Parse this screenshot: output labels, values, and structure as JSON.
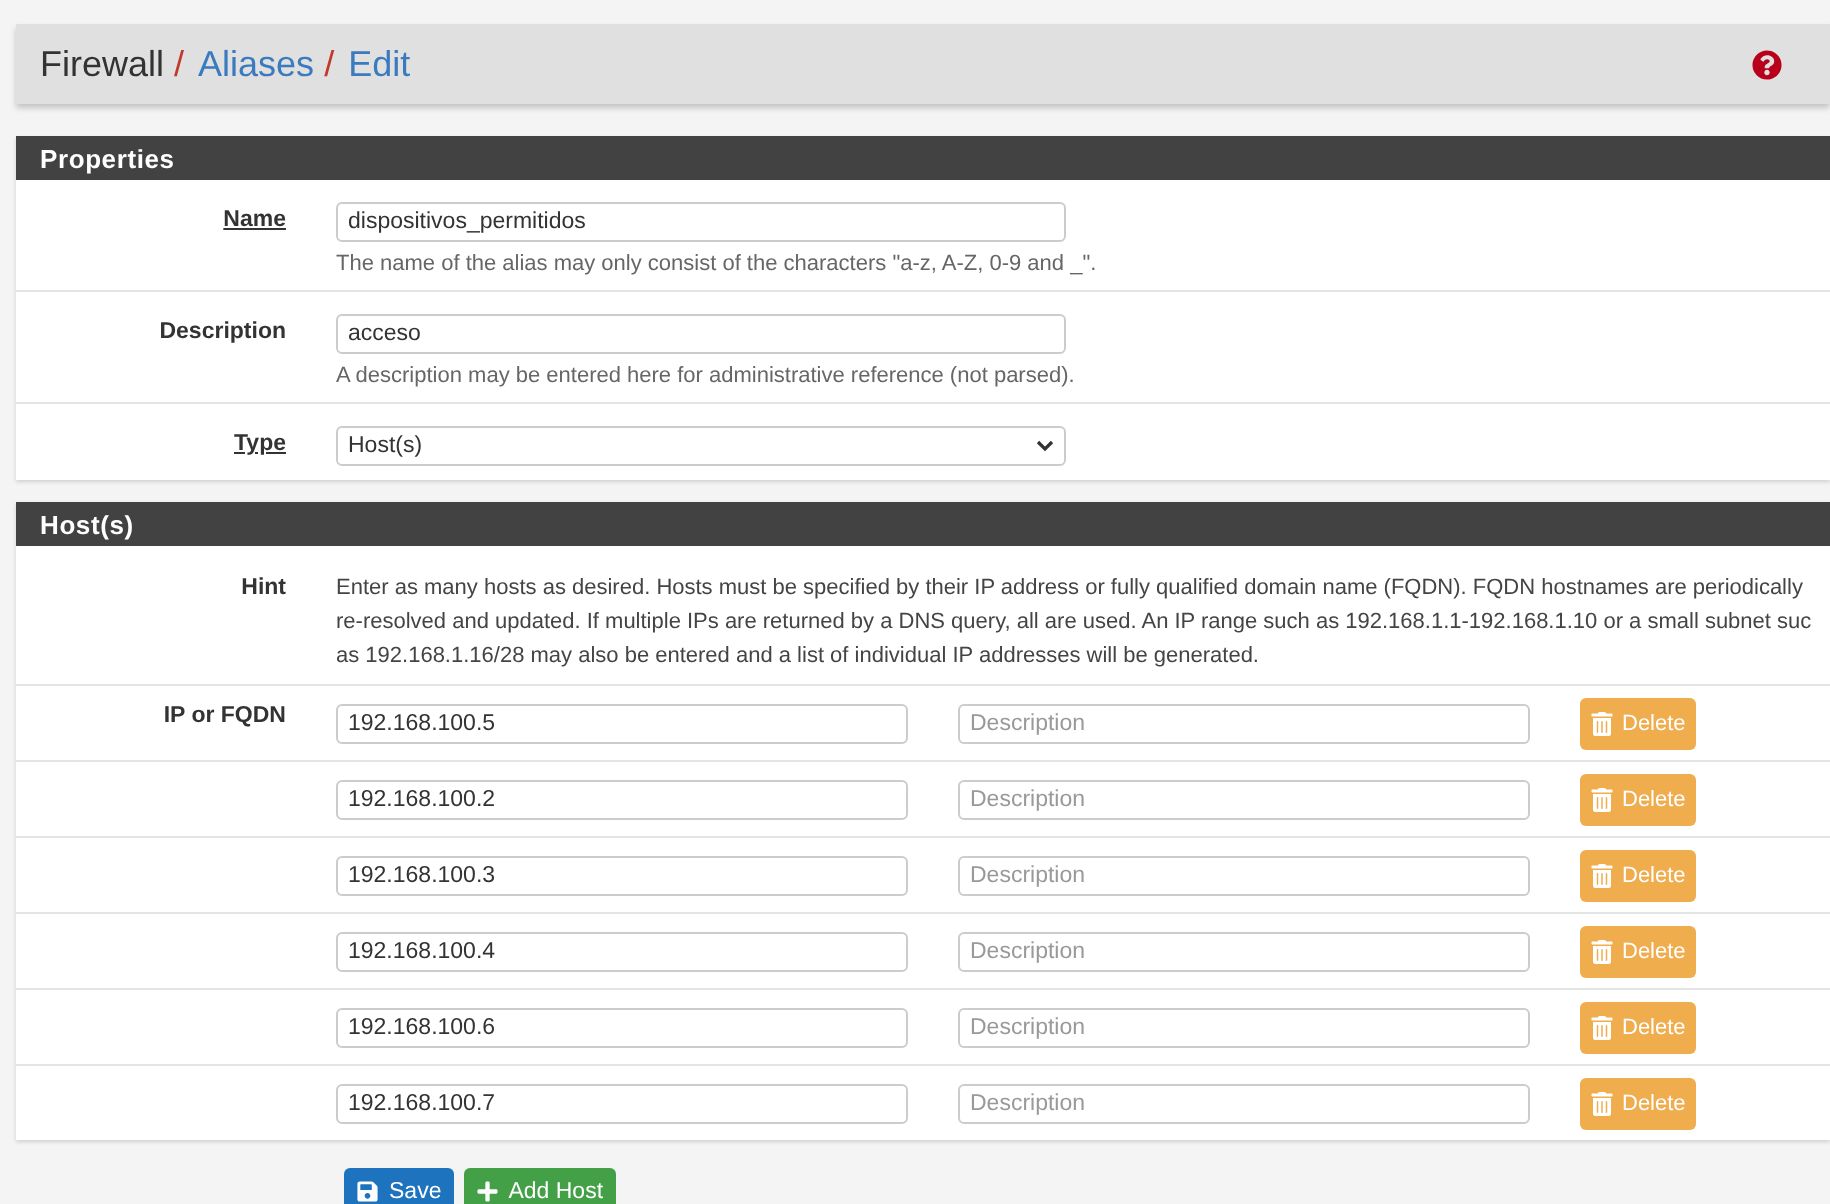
{
  "breadcrumb": [
    {
      "text": "Firewall",
      "link": false,
      "separator": "/"
    },
    {
      "text": "Aliases",
      "link": true,
      "separator": "/"
    },
    {
      "text": "Edit",
      "link": true
    }
  ],
  "properties": {
    "title": "Properties",
    "fields": [
      {
        "label": "Name",
        "kind": "text",
        "help_link": true,
        "value": "dispositivos_permitidos",
        "hint": "The name of the alias may only consist of the characters \"a-z, A-Z, 0-9 and _\"."
      },
      {
        "label": "Description",
        "kind": "text",
        "help_link": false,
        "value": "acceso",
        "hint": "A description may be entered here for administrative reference (not parsed)."
      },
      {
        "label": "Type",
        "kind": "select",
        "help_link": true,
        "value": "Host(s)"
      }
    ]
  },
  "hosts": {
    "title": "Host(s)",
    "hint_label": "Hint",
    "hint_lines": [
      "Enter as many hosts as desired. Hosts must be specified by their IP address or fully qualified domain name (FQDN). FQDN hostnames are periodically",
      "re-resolved and updated. If multiple IPs are returned by a DNS query, all are used. An IP range such as 192.168.1.1-192.168.1.10 or a small subnet suc",
      "as 192.168.1.16/28 may also be entered and a list of individual IP addresses will be generated."
    ],
    "row_label": "IP or FQDN",
    "rows": [
      {
        "address": "192.168.100.5",
        "description_placeholder": "Description",
        "delete": "Delete"
      },
      {
        "address": "192.168.100.2",
        "description_placeholder": "Description",
        "delete": "Delete"
      },
      {
        "address": "192.168.100.3",
        "description_placeholder": "Description",
        "delete": "Delete"
      },
      {
        "address": "192.168.100.4",
        "description_placeholder": "Description",
        "delete": "Delete"
      },
      {
        "address": "192.168.100.6",
        "description_placeholder": "Description",
        "delete": "Delete"
      },
      {
        "address": "192.168.100.7",
        "description_placeholder": "Description",
        "delete": "Delete"
      }
    ]
  },
  "buttons": [
    {
      "label": "Save",
      "kind": "save"
    },
    {
      "label": "Add Host",
      "kind": "add"
    }
  ]
}
